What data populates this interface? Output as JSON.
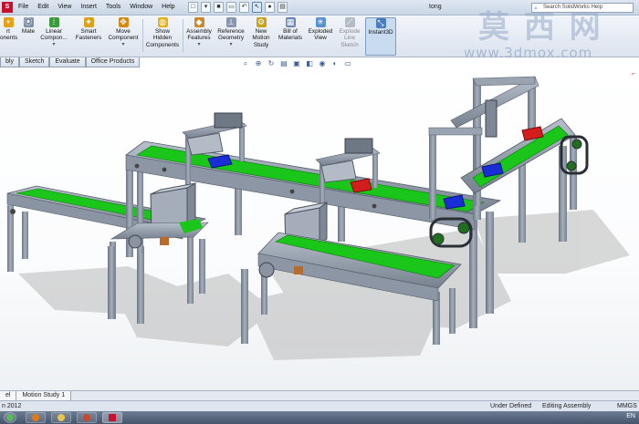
{
  "menu": [
    "File",
    "Edit",
    "View",
    "Insert",
    "Tools",
    "Window",
    "Help"
  ],
  "document_title": "tong",
  "search_placeholder": "Search SolidWorks Help",
  "ribbon": {
    "insert_components": "rt\nonents",
    "mate": "Mate",
    "linear_component": "Linear\nCompon...",
    "smart_fasteners": "Smart\nFasteners",
    "move_component": "Move\nComponent",
    "show_hidden": "Show\nHidden\nComponents",
    "assembly_features": "Assembly\nFeatures",
    "reference_geometry": "Reference\nGeometry",
    "new_motion_study": "New\nMotion\nStudy",
    "bill_of_materials": "Bill of\nMaterials",
    "exploded_view": "Exploded\nView",
    "explode_line_sketch": "Explode\nLine\nSketch",
    "instant3d": "Instant3D"
  },
  "tabs": [
    "bly",
    "Sketch",
    "Evaluate",
    "Office Products"
  ],
  "watermark": {
    "big": "莫 西 网",
    "url": "www.3dmox.com"
  },
  "model_tabs": [
    "el",
    "Motion Study 1"
  ],
  "status": {
    "left": "n 2012",
    "under_defined": "Under Defined",
    "editing": "Editing Assembly",
    "units": "MMGS"
  },
  "tray": {
    "lang": "EN"
  },
  "colors": {
    "frame": "#8e97a6",
    "belt": "#19c619",
    "box_red": "#d41e1e",
    "box_blue": "#1a2ed8",
    "accent": "#c8102e"
  },
  "icons": [
    "new-document-icon",
    "open-icon",
    "save-icon",
    "print-icon",
    "undo-icon",
    "select-icon",
    "rebuild-icon",
    "options-icon",
    "zoom-fit-icon",
    "zoom-area-icon",
    "rotate-icon",
    "section-icon",
    "view-orientation-icon",
    "display-style-icon",
    "appearance-icon",
    "scene-icon",
    "triad-icon"
  ]
}
